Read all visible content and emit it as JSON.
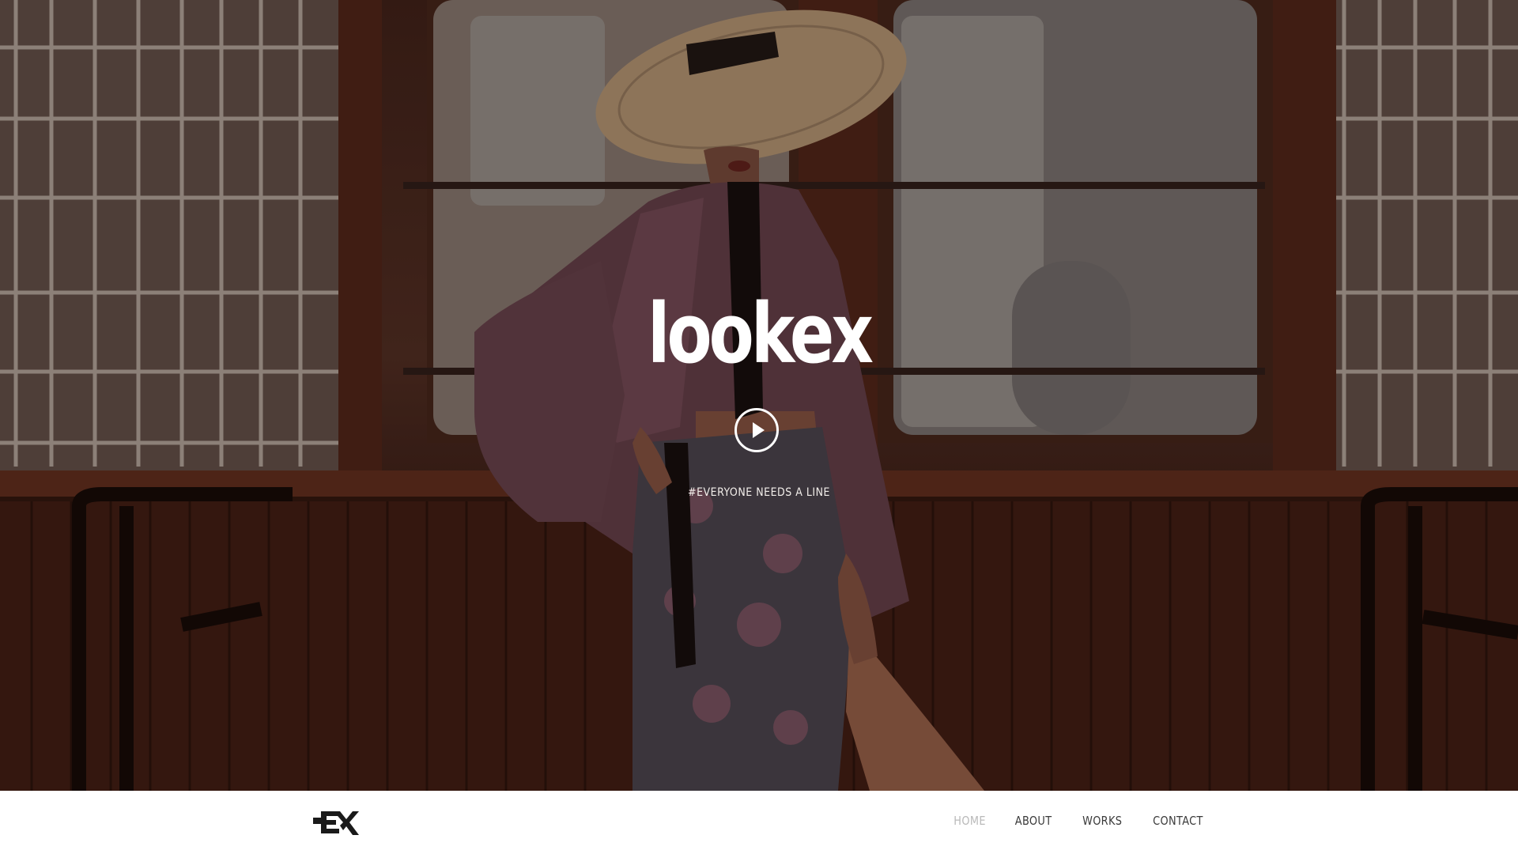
{
  "hero": {
    "title": "lookex",
    "tagline": "#EVERYONE NEEDS A LINE",
    "play_icon": "play-icon"
  },
  "nav": {
    "logo_icon": "ex-logo-icon",
    "items": [
      {
        "label": "HOME",
        "active": true
      },
      {
        "label": "ABOUT",
        "active": false
      },
      {
        "label": "WORKS",
        "active": false
      },
      {
        "label": "CONTACT",
        "active": false
      }
    ]
  },
  "colors": {
    "nav_active": "#b9b9b9",
    "nav_text": "#3a3a3a",
    "hero_text": "#ffffff"
  }
}
